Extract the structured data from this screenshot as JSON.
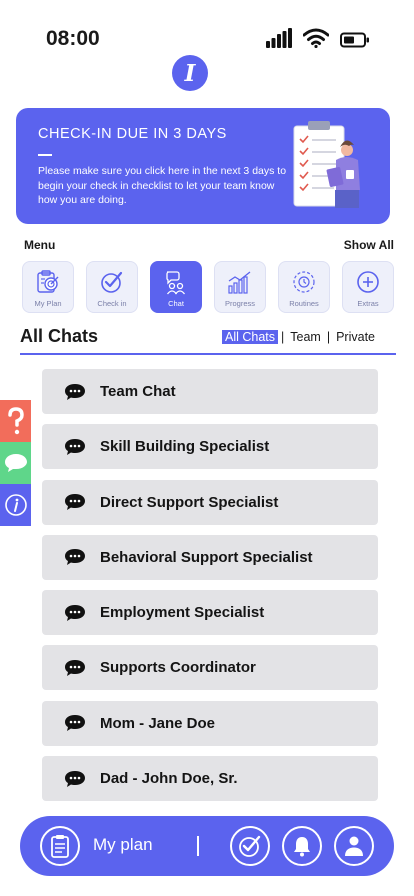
{
  "status_bar": {
    "time": "08:00",
    "icons": [
      "cellular-signal-icon",
      "wifi-icon",
      "battery-icon"
    ]
  },
  "app": {
    "logo_letter": "I"
  },
  "banner": {
    "title": "CHECK-IN DUE IN 3 DAYS",
    "text": "Please make sure you click here in the next 3 days to begin your check in checklist to let your team know how you are doing."
  },
  "menu": {
    "label": "Menu",
    "show_all": "Show All",
    "items": [
      {
        "label": "My Plan",
        "icon": "target-plan-icon",
        "active": false
      },
      {
        "label": "Check in",
        "icon": "check-circle-icon",
        "active": false
      },
      {
        "label": "Chat",
        "icon": "people-chat-icon",
        "active": true
      },
      {
        "label": "Progress",
        "icon": "bar-chart-icon",
        "active": false
      },
      {
        "label": "Routines",
        "icon": "clock-cycle-icon",
        "active": false
      },
      {
        "label": "Extras",
        "icon": "plus-circle-icon",
        "active": false
      }
    ]
  },
  "chats": {
    "title": "All Chats",
    "filters": [
      "All Chats",
      "Team",
      "Private"
    ],
    "active_filter": "All Chats",
    "items": [
      {
        "label": "Team Chat"
      },
      {
        "label": "Skill Building Specialist"
      },
      {
        "label": "Direct Support Specialist"
      },
      {
        "label": "Behavioral Support Specialist"
      },
      {
        "label": "Employment Specialist"
      },
      {
        "label": "Supports Coordinator"
      },
      {
        "label": "Mom - Jane Doe"
      },
      {
        "label": "Dad - John Doe, Sr."
      }
    ]
  },
  "side_tabs": [
    {
      "icon": "help-icon",
      "color": "#f26d5b"
    },
    {
      "icon": "chat-bubble-icon",
      "color": "#5fd68a"
    },
    {
      "icon": "info-icon",
      "color": "#5b63ee"
    }
  ],
  "bottom_nav": {
    "plan_label": "My plan",
    "icons": [
      "clipboard-icon",
      "check-circle-icon",
      "bell-icon",
      "profile-icon"
    ]
  },
  "colors": {
    "accent": "#5b63ee",
    "chat_item_bg": "#e3e3e6",
    "help": "#f26d5b",
    "chat": "#5fd68a"
  }
}
